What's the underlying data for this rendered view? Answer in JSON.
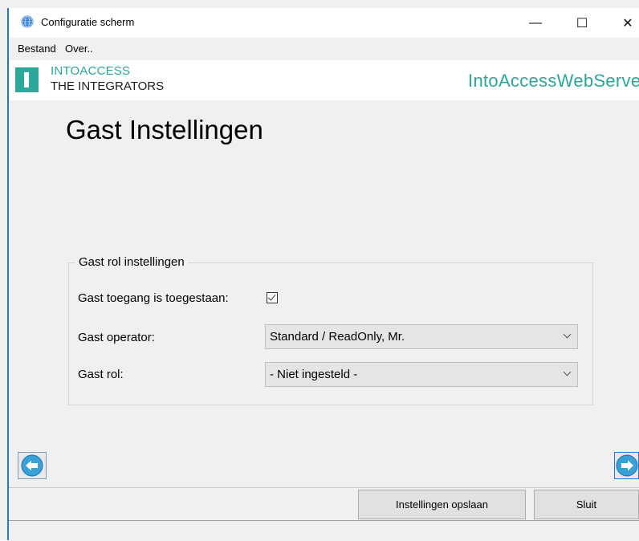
{
  "window": {
    "title": "Configuratie scherm",
    "minimize_glyph": "—",
    "maximize_glyph": "☐",
    "close_glyph": "✕"
  },
  "menu": {
    "items": [
      "Bestand",
      "Over.."
    ]
  },
  "banner": {
    "logo_line1": "INTOACCESS",
    "logo_line2": "THE INTEGRATORS",
    "server_name": "IntoAccessWebServer"
  },
  "page": {
    "title": "Gast Instellingen"
  },
  "group": {
    "legend": "Gast rol instellingen",
    "guest_access_label": "Gast toegang is toegestaan:",
    "guest_access_checked": true,
    "operator_label": "Gast operator:",
    "operator_value": "Standard / ReadOnly, Mr.",
    "role_label": "Gast rol:",
    "role_value": "- Niet ingesteld -"
  },
  "nav": {
    "back_icon": "arrow-left-circle",
    "forward_icon": "arrow-right-circle"
  },
  "footer": {
    "save_label": "Instellingen opslaan",
    "close_label": "Sluit"
  },
  "colors": {
    "accent": "#2aa89a",
    "nav_icon": "#3aa0d8"
  }
}
